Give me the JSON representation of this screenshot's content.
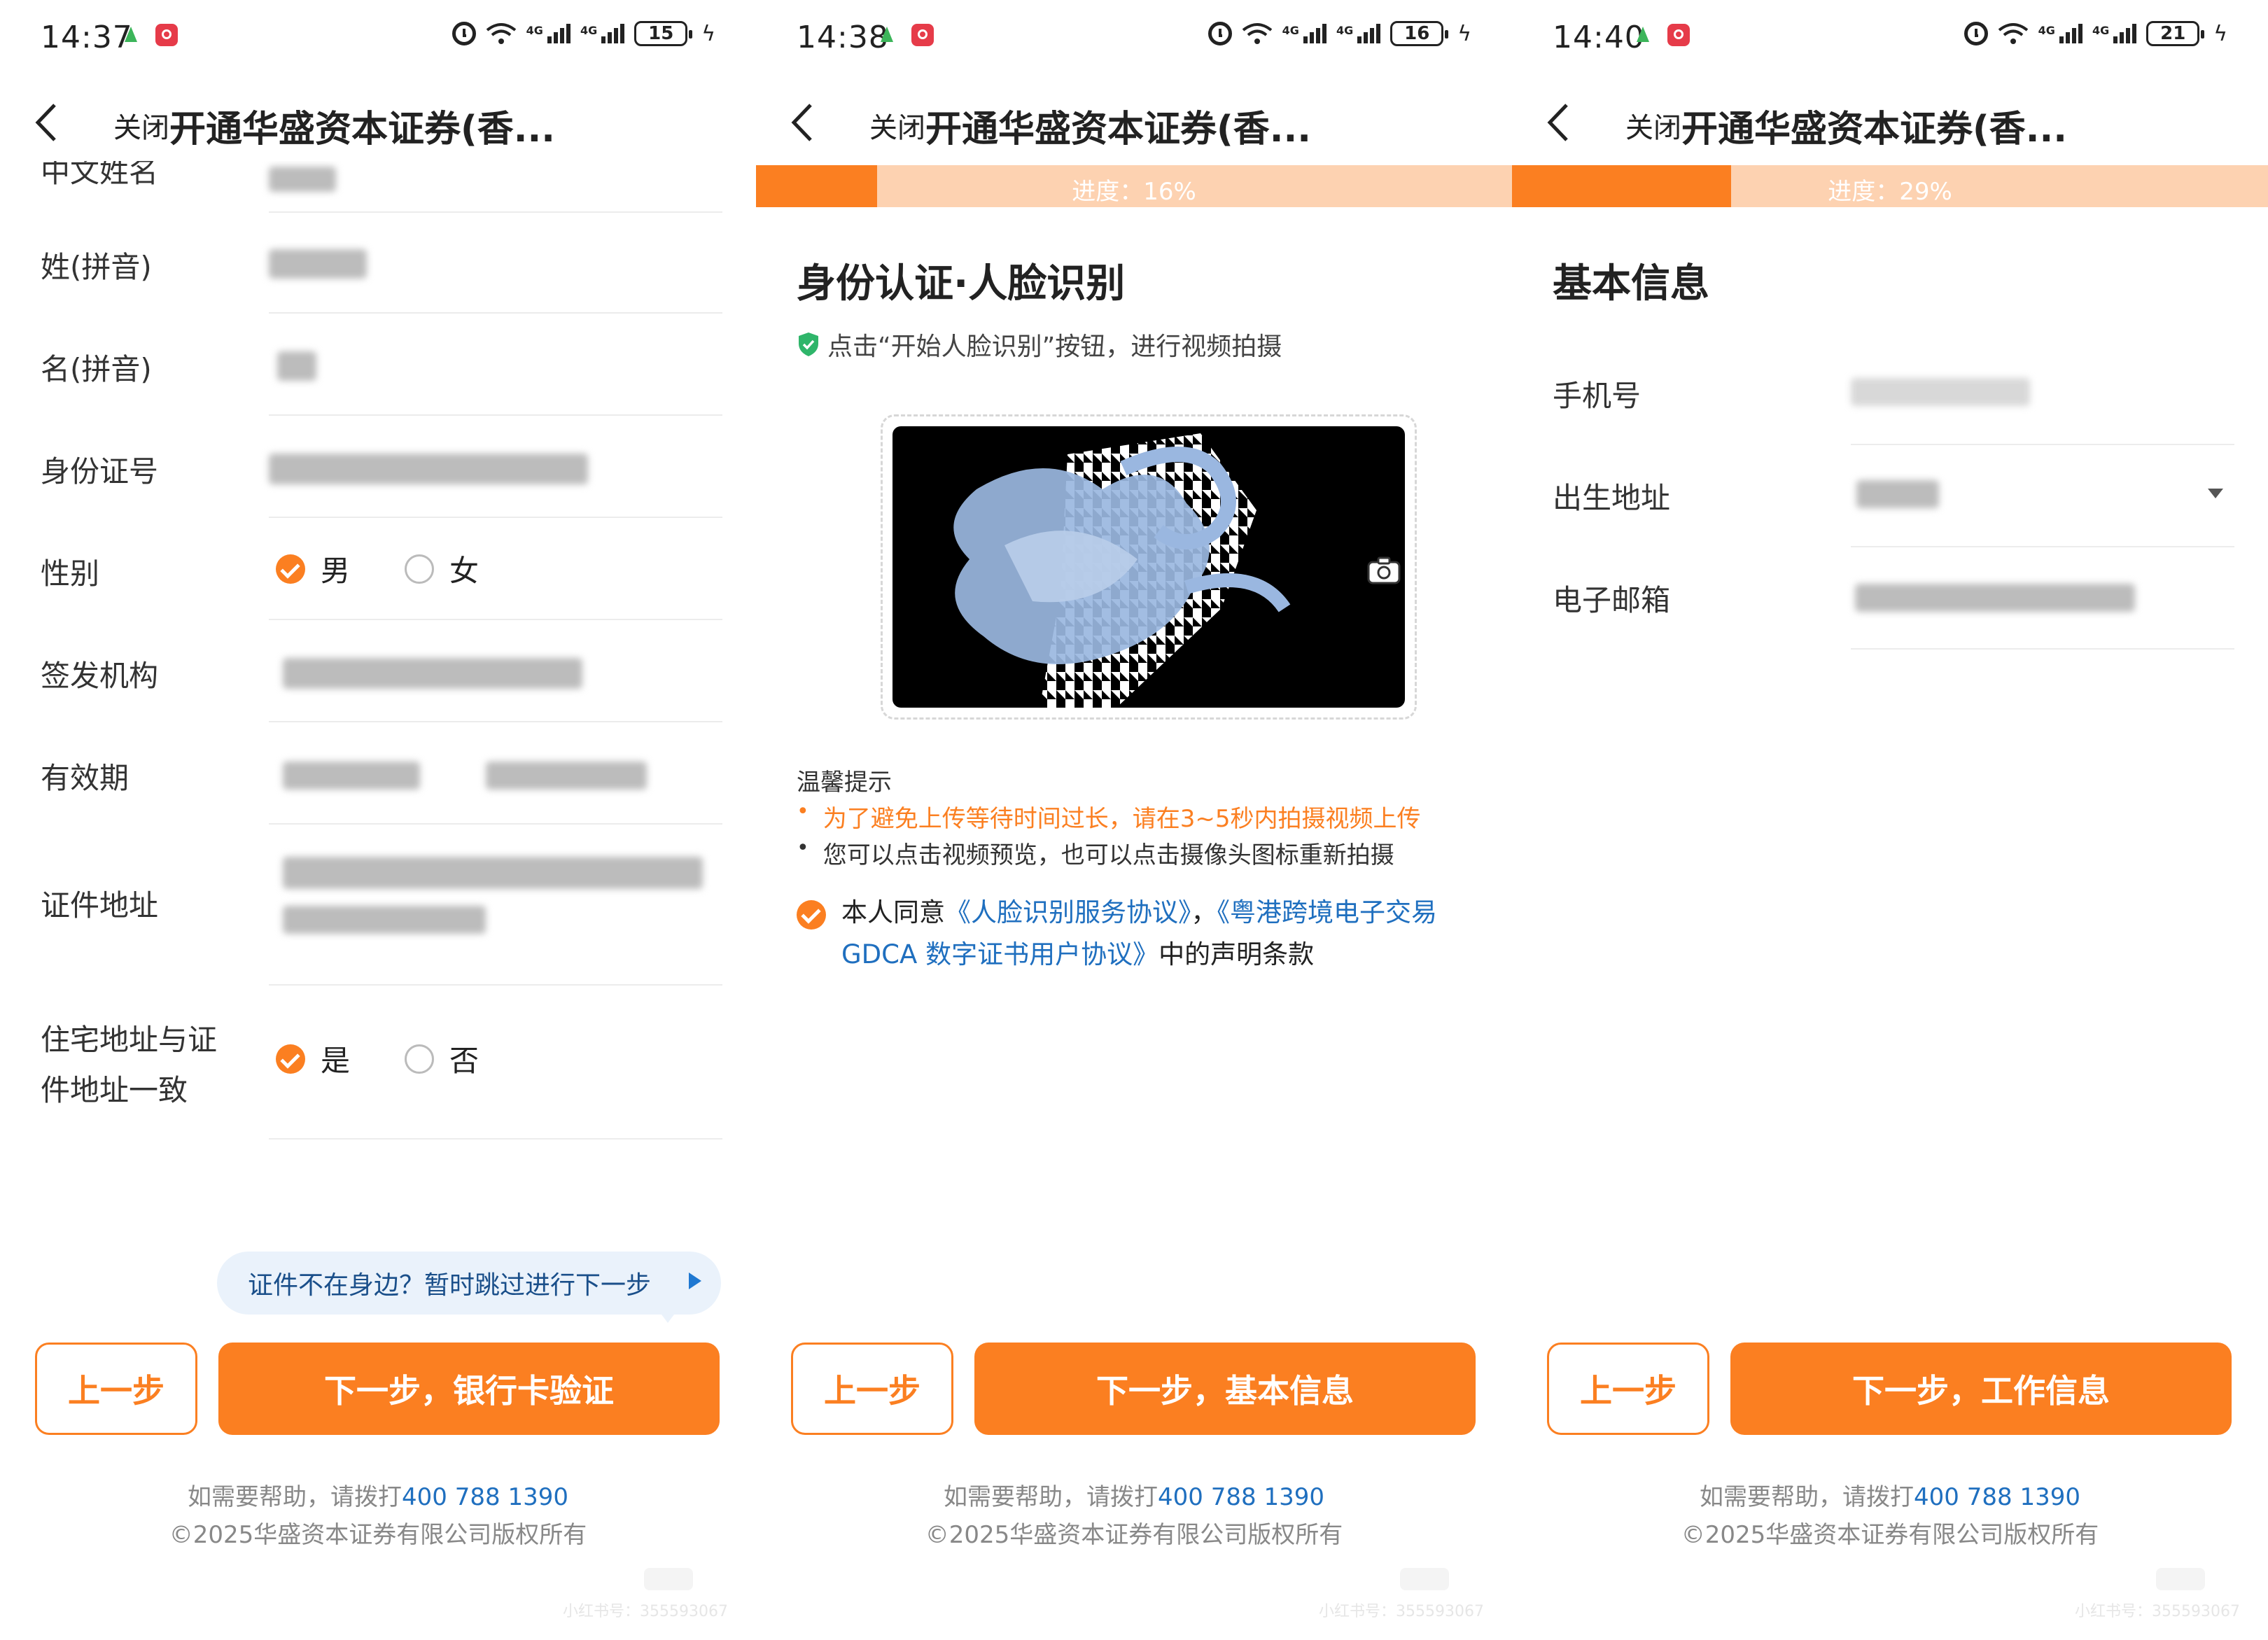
{
  "colors": {
    "accent": "#fb7f21",
    "progress_track": "#fdd2b1",
    "link": "#1f6fbf",
    "bubble_bg": "#eaf2fb"
  },
  "common": {
    "close_label": "关闭",
    "title": "开通华盛资本证券(香...",
    "help_prefix": "如需要帮助，请拨打",
    "help_phone": "400 788 1390",
    "copyright": "©2025华盛资本证券有限公司版权所有",
    "prev_label": "上一步",
    "watermark": "小红书号：355593067"
  },
  "panels": [
    {
      "status": {
        "time": "14:37",
        "battery": "15"
      },
      "form": {
        "partial_label": "中文姓名",
        "fields": [
          {
            "label": "姓(拼音)"
          },
          {
            "label": "名(拼音)"
          },
          {
            "label": "身份证号"
          },
          {
            "label": "性别",
            "options": [
              "男",
              "女"
            ],
            "selected": "男"
          },
          {
            "label": "签发机构"
          },
          {
            "label": "有效期"
          },
          {
            "label": "证件地址"
          },
          {
            "label": "住宅地址与证件地址一致",
            "options": [
              "是",
              "否"
            ],
            "selected": "是"
          }
        ]
      },
      "skip_text": "证件不在身边？暂时跳过进行下一步",
      "next_label": "下一步，银行卡验证"
    },
    {
      "status": {
        "time": "14:38",
        "battery": "16"
      },
      "progress": {
        "label": "进度：16%",
        "percent": 16
      },
      "section_title": "身份认证·人脸识别",
      "hint": "点击“开始人脸识别”按钮，进行视频拍摄",
      "tips_title": "温馨提示",
      "tips": [
        "为了避免上传等待时间过长，请在3~5秒内拍摄视频上传",
        "您可以点击视频预览，也可以点击摄像头图标重新拍摄"
      ],
      "agreement": {
        "prefix": "本人同意",
        "link1": "《人脸识别服务协议》",
        "sep": "，",
        "link2": "《粤港跨境电子交易GDCA 数字证书用户协议》",
        "suffix": "中的声明条款"
      },
      "next_label": "下一步，基本信息"
    },
    {
      "status": {
        "time": "14:40",
        "battery": "21"
      },
      "progress": {
        "label": "进度：29%",
        "percent": 29
      },
      "section_title": "基本信息",
      "fields": [
        {
          "label": "手机号"
        },
        {
          "label": "出生地址"
        },
        {
          "label": "电子邮箱"
        }
      ],
      "next_label": "下一步，工作信息"
    }
  ]
}
